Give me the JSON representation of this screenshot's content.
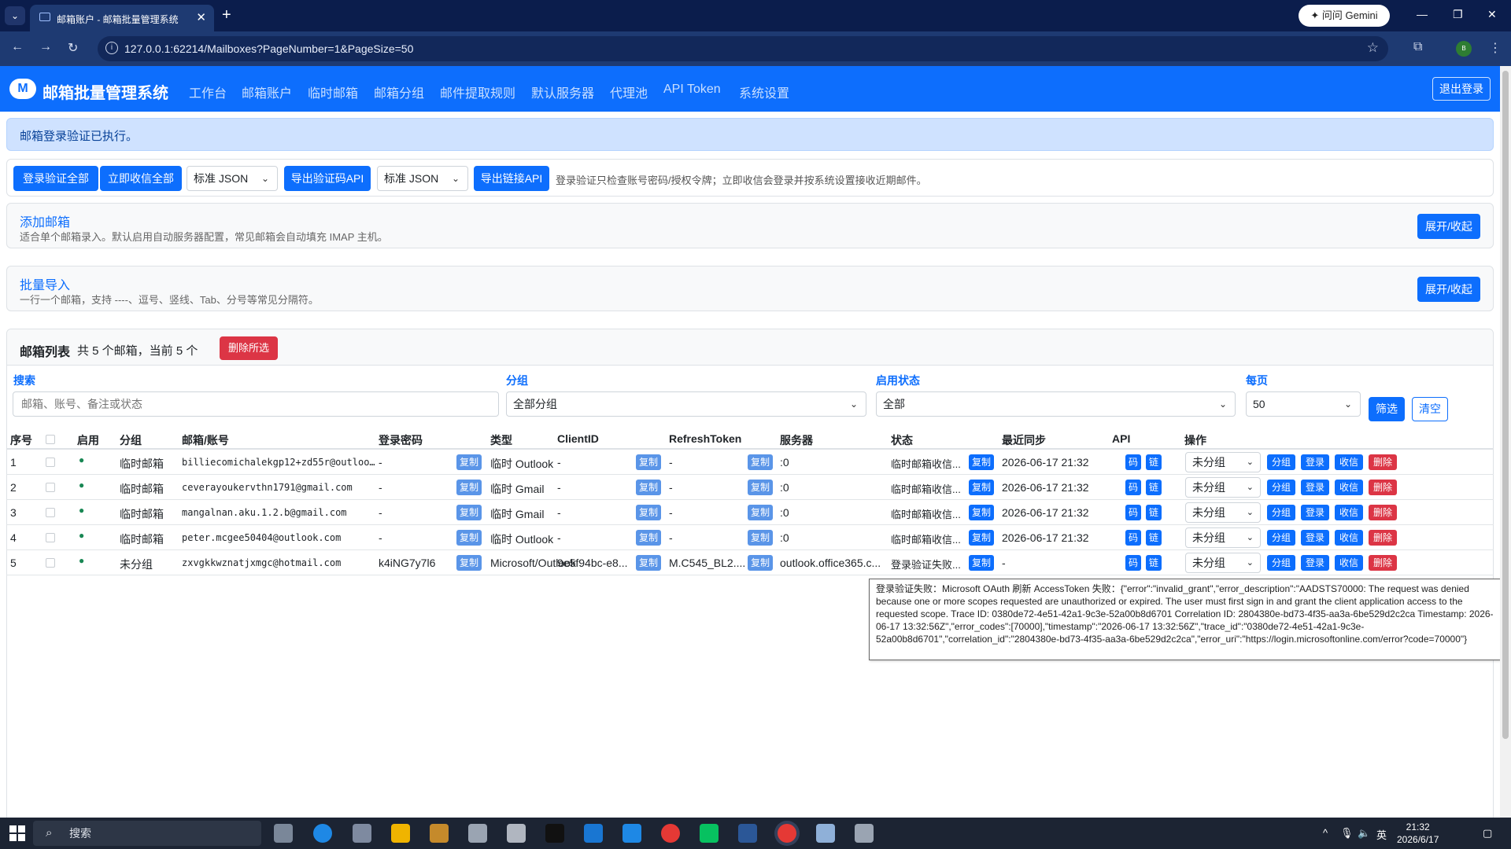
{
  "browser": {
    "tab_title": "邮箱账户 - 邮箱批量管理系统",
    "url": "127.0.0.1:62214/Mailboxes?PageNumber=1&PageSize=50",
    "gemini_label": "问问 Gemini",
    "profile_initials": "B"
  },
  "app": {
    "logo_letter": "M",
    "brand": "邮箱批量管理系统",
    "nav": [
      "工作台",
      "邮箱账户",
      "临时邮箱",
      "邮箱分组",
      "邮件提取规则",
      "默认服务器",
      "代理池",
      "API Token",
      "系统设置"
    ],
    "logout": "退出登录"
  },
  "alert": "邮箱登录验证已执行。",
  "toolbar": {
    "verify_all": "登录验证全部",
    "receive_all": "立即收信全部",
    "format1": "标准 JSON",
    "export_code_api": "导出验证码API",
    "format2": "标准 JSON",
    "export_link_api": "导出链接API",
    "hint": "登录验证只检查账号密码/授权令牌；立即收信会登录并按系统设置接收近期邮件。"
  },
  "add_card": {
    "title": "添加邮箱",
    "desc": "适合单个邮箱录入。默认启用自动服务器配置，常见邮箱会自动填充 IMAP 主机。",
    "toggle": "展开/收起"
  },
  "import_card": {
    "title": "批量导入",
    "desc": "一行一个邮箱，支持 ----、逗号、竖线、Tab、分号等常见分隔符。",
    "toggle": "展开/收起"
  },
  "list": {
    "title": "邮箱列表",
    "summary": "共 5 个邮箱，当前 5 个",
    "delete_selected": "删除所选",
    "filters": {
      "search_label": "搜索",
      "search_placeholder": "邮箱、账号、备注或状态",
      "group_label": "分组",
      "group_value": "全部分组",
      "enabled_label": "启用状态",
      "enabled_value": "全部",
      "perpage_label": "每页",
      "perpage_value": "50",
      "filter_btn": "筛选",
      "clear_btn": "清空"
    },
    "columns": [
      "序号",
      "启用",
      "分组",
      "邮箱/账号",
      "登录密码",
      "类型",
      "ClientID",
      "RefreshToken",
      "服务器",
      "状态",
      "最近同步",
      "API",
      "操作"
    ],
    "copy_label": "复制",
    "api_code": "码",
    "api_link": "链",
    "actions": {
      "group": "分组",
      "login": "登录",
      "receive": "收信",
      "delete": "删除"
    },
    "enabled_dot": "●",
    "rows": [
      {
        "no": "1",
        "group": "临时邮箱",
        "email": "billiecomichalekgp12+zd55r@outloo…",
        "password": "-",
        "type": "临时 Outlook",
        "client_id": "-",
        "token": "-",
        "server": ":0",
        "status": "临时邮箱收信...",
        "sync": "2026-06-17 21:32",
        "group_select": "未分组"
      },
      {
        "no": "2",
        "group": "临时邮箱",
        "email": "ceverayoukervthn1791@gmail.com",
        "password": "-",
        "type": "临时 Gmail",
        "client_id": "-",
        "token": "-",
        "server": ":0",
        "status": "临时邮箱收信...",
        "sync": "2026-06-17 21:32",
        "group_select": "未分组"
      },
      {
        "no": "3",
        "group": "临时邮箱",
        "email": "mangalnan.aku.1.2.b@gmail.com",
        "password": "-",
        "type": "临时 Gmail",
        "client_id": "-",
        "token": "-",
        "server": ":0",
        "status": "临时邮箱收信...",
        "sync": "2026-06-17 21:32",
        "group_select": "未分组"
      },
      {
        "no": "4",
        "group": "临时邮箱",
        "email": "peter.mcgee50404@outlook.com",
        "password": "-",
        "type": "临时 Outlook",
        "client_id": "-",
        "token": "-",
        "server": ":0",
        "status": "临时邮箱收信...",
        "sync": "2026-06-17 21:32",
        "group_select": "未分组"
      },
      {
        "no": "5",
        "group": "未分组",
        "email": "zxvgkkwznatjxmgc@hotmail.com",
        "password": "k4iNG7y7l6",
        "type": "Microsoft/Outlook",
        "client_id": "9e5f94bc-e8...",
        "token": "M.C545_BL2....",
        "server": "outlook.office365.c...",
        "status": "登录验证失败...",
        "sync": "-",
        "group_select": "未分组"
      }
    ]
  },
  "tooltip": "登录验证失败：Microsoft OAuth 刷新 AccessToken 失败：{\"error\":\"invalid_grant\",\"error_description\":\"AADSTS70000: The request was denied because one or more scopes requested are unauthorized or expired. The user must first sign in and grant the client application access to the requested scope. Trace ID: 0380de72-4e51-42a1-9c3e-52a00b8d6701 Correlation ID: 2804380e-bd73-4f35-aa3a-6be529d2c2ca Timestamp: 2026-06-17 13:32:56Z\",\"error_codes\":[70000],\"timestamp\":\"2026-06-17 13:32:56Z\",\"trace_id\":\"0380de72-4e51-42a1-9c3e-52a00b8d6701\",\"correlation_id\":\"2804380e-bd73-4f35-aa3a-6be529d2c2ca\",\"error_uri\":\"https://login.microsoftonline.com/error?code=70000\"}",
  "taskbar": {
    "search": "搜索",
    "ime": "英",
    "time": "21:32",
    "date": "2026/6/17"
  }
}
